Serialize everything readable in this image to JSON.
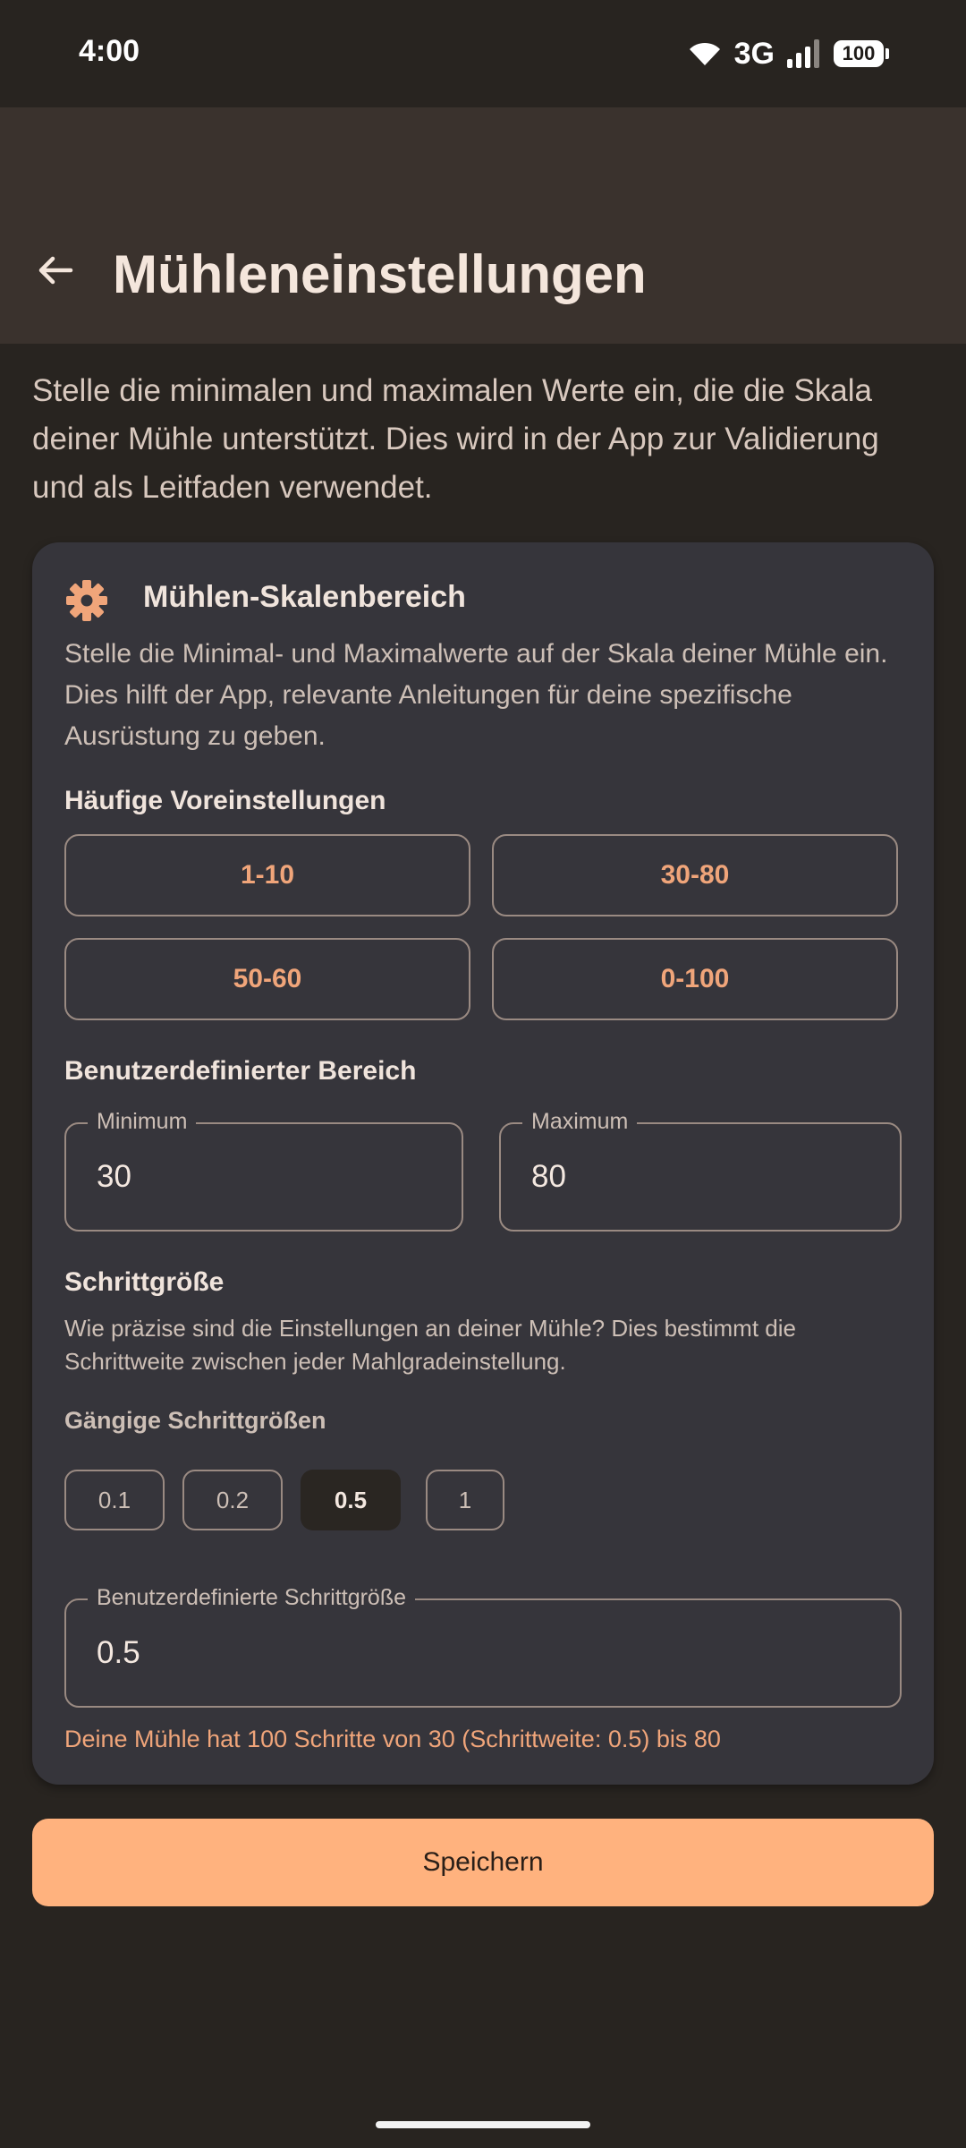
{
  "status_bar": {
    "time": "4:00",
    "network": "3G",
    "battery": "100",
    "icons": [
      "wifi-icon",
      "signal-icon",
      "battery-icon"
    ]
  },
  "app_bar": {
    "title": "Mühleneinstellungen",
    "back_icon": "arrow-left-icon"
  },
  "intro_text": "Stelle die minimalen und maximalen Werte ein, die die Skala deiner Mühle unterstützt. Dies wird in der App zur Validierung und als Leitfaden verwendet.",
  "card": {
    "icon": "gear-icon",
    "title": "Mühlen-Skalenbereich",
    "description": "Stelle die Minimal- und Maximalwerte auf der Skala deiner Mühle ein. Dies hilft der App, relevante Anleitungen für deine spezifische Ausrüstung zu geben.",
    "presets_label": "Häufige Voreinstellungen",
    "presets": [
      "1-10",
      "30-80",
      "50-60",
      "0-100"
    ],
    "custom_range_label": "Benutzerdefinierter Bereich",
    "minimum": {
      "label": "Minimum",
      "value": "30"
    },
    "maximum": {
      "label": "Maximum",
      "value": "80"
    },
    "step_label": "Schrittgröße",
    "step_description": "Wie präzise sind die Einstellungen an deiner Mühle? Dies bestimmt die Schrittweite zwischen jeder Mahlgradeinstellung.",
    "common_steps_label": "Gängige Schrittgrößen",
    "common_steps": [
      "0.1",
      "0.2",
      "0.5",
      "1"
    ],
    "selected_step": "0.5",
    "custom_step": {
      "label": "Benutzerdefinierte Schrittgröße",
      "value": "0.5"
    },
    "summary": "Deine Mühle hat 100 Schritte von 30 (Schrittweite: 0.5) bis 80"
  },
  "save_label": "Speichern",
  "colors": {
    "background": "#282420",
    "app_bar": "#3a322d",
    "card": "#36353b",
    "accent": "#f0a57a",
    "button": "#ffb27e"
  }
}
